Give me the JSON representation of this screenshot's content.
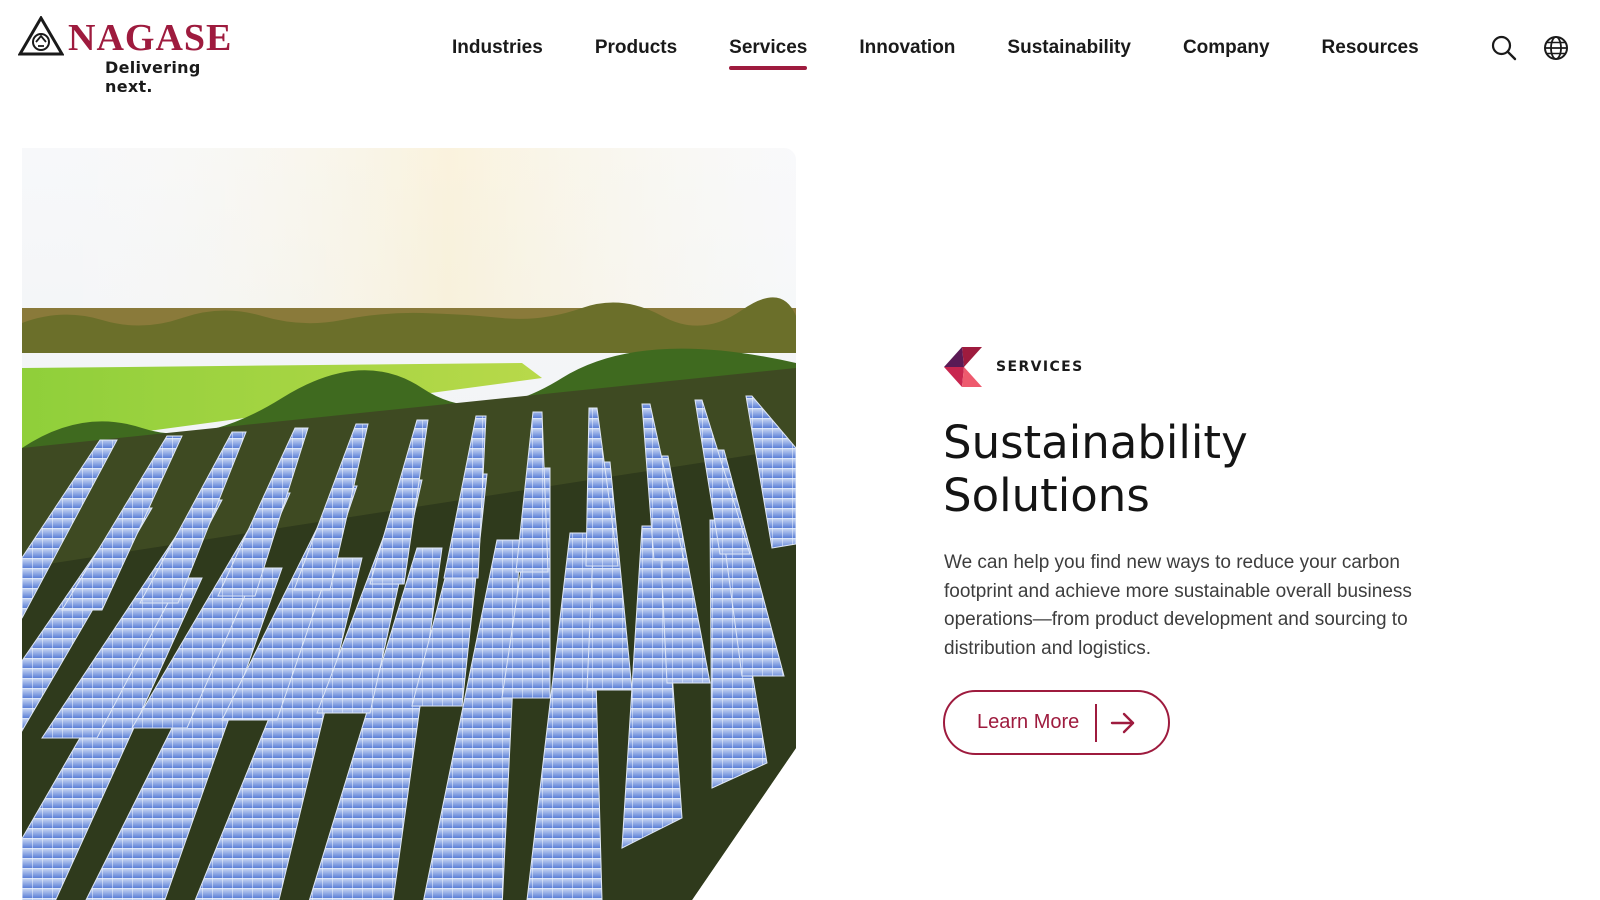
{
  "brand": {
    "name": "NAGASE",
    "tagline": "Delivering next.",
    "accent_color": "#9e1b3e"
  },
  "nav": {
    "items": [
      {
        "label": "Industries",
        "active": false
      },
      {
        "label": "Products",
        "active": false
      },
      {
        "label": "Services",
        "active": true
      },
      {
        "label": "Innovation",
        "active": false
      },
      {
        "label": "Sustainability",
        "active": false
      },
      {
        "label": "Company",
        "active": false
      },
      {
        "label": "Resources",
        "active": false
      }
    ],
    "icons": [
      "search-icon",
      "globe-icon"
    ]
  },
  "hero": {
    "image": "solar-panel-field",
    "eyebrow": "SERVICES",
    "headline_line1": "Sustainability",
    "headline_line2": "Solutions",
    "description": "We can help you find new ways to reduce your carbon footprint and achieve more sustainable overall business operations—from product development and sourcing to distribution and logistics.",
    "cta_label": "Learn More",
    "cta_icon": "arrow-right-icon"
  }
}
